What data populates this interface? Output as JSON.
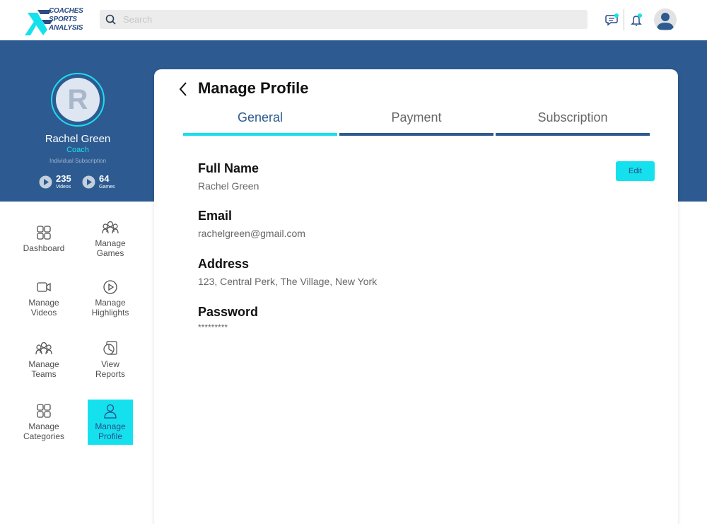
{
  "logo": {
    "line1": "COACHES",
    "line2": "SPORTS",
    "line3": "ANALYSIS"
  },
  "search": {
    "placeholder": "Search"
  },
  "icons": {
    "chat": "chat-icon",
    "bell": "bell-icon",
    "avatar": "user-avatar-icon",
    "back": "chevron-left-icon"
  },
  "colors": {
    "brand_blue": "#2d5b91",
    "accent_cyan": "#15e1ee"
  },
  "profile": {
    "initial": "R",
    "name": "Rachel Green",
    "role": "Coach",
    "subscription": "Individual Subscription",
    "videos_count": "235",
    "videos_label": "Videos",
    "games_count": "64",
    "games_label": "Games"
  },
  "nav": {
    "dashboard": "Dashboard",
    "manage_games": "Manage Games",
    "manage_videos": "Manage Videos",
    "manage_highlights": "Manage Highlights",
    "manage_teams": "Manage Teams",
    "view_reports": "View Reports",
    "manage_categories": "Manage Categories",
    "manage_profile": "Manage Profile"
  },
  "card": {
    "title": "Manage Profile",
    "tabs": [
      "General",
      "Payment",
      "Subscription"
    ],
    "active_tab": "General",
    "edit_label": "Edit",
    "fields": {
      "full_name_label": "Full Name",
      "full_name_value": "Rachel Green",
      "email_label": "Email",
      "email_value": "rachelgreen@gmail.com",
      "address_label": "Address",
      "address_value": "123, Central Perk, The Village, New York",
      "password_label": "Password",
      "password_value": "*********"
    }
  }
}
